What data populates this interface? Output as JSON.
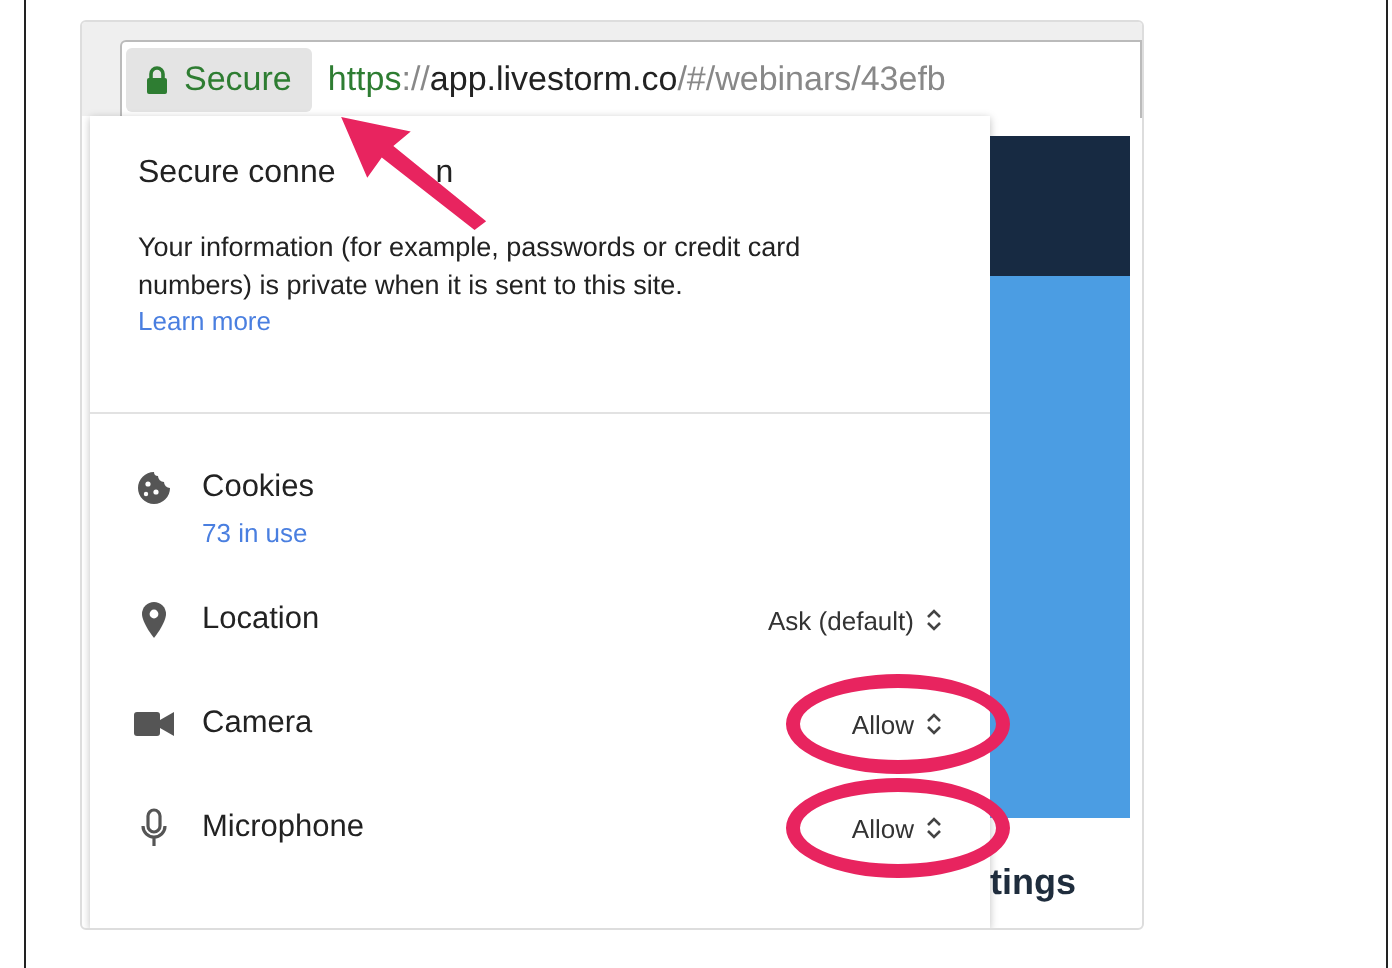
{
  "address_bar": {
    "security_label": "Secure",
    "url": {
      "scheme": "https",
      "separator": "://",
      "host": "app.livestorm.co",
      "path": "/#/webinars/43efb"
    }
  },
  "popup": {
    "title_parts": [
      "Secure conne",
      "n"
    ],
    "description": "Your information (for example, passwords or credit card numbers) is private when it is sent to this site.",
    "link": "Learn more",
    "cookies": {
      "label": "Cookies",
      "count": "73 in use"
    },
    "permissions": [
      {
        "kind": "location",
        "label": "Location",
        "value": "Ask (default)",
        "highlighted": false
      },
      {
        "kind": "camera",
        "label": "Camera",
        "value": "Allow",
        "highlighted": true
      },
      {
        "kind": "microphone",
        "label": "Microphone",
        "value": "Allow",
        "highlighted": true
      }
    ]
  },
  "page": {
    "heading_fragment": "tings"
  }
}
